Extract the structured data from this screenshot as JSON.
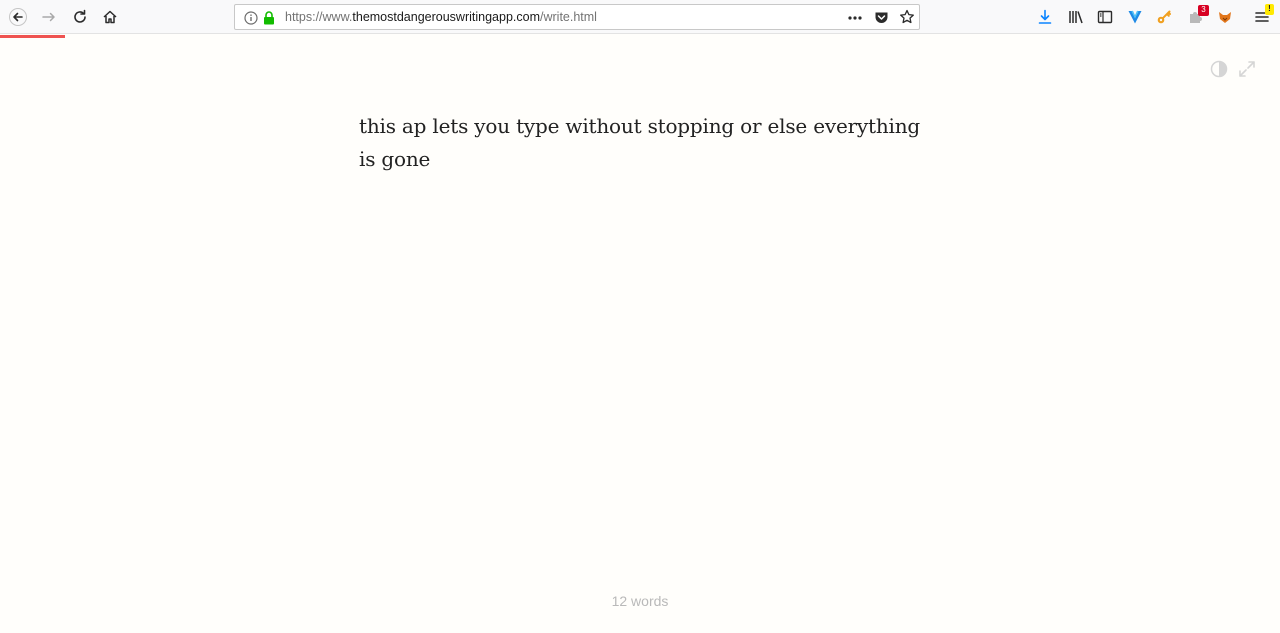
{
  "browser": {
    "url_prefix": "https://www.",
    "url_domain": "themostdangerouswritingapp.com",
    "url_path": "/write.html",
    "addon_badge_count": "3",
    "menu_badge": "!"
  },
  "editor": {
    "text": "this ap lets you type without stopping or else everything is gone",
    "word_count_label": "12 words"
  },
  "colors": {
    "accent_progress": "#ef5350",
    "download_icon": "#0a84ff",
    "lock_icon": "#12bc00"
  }
}
